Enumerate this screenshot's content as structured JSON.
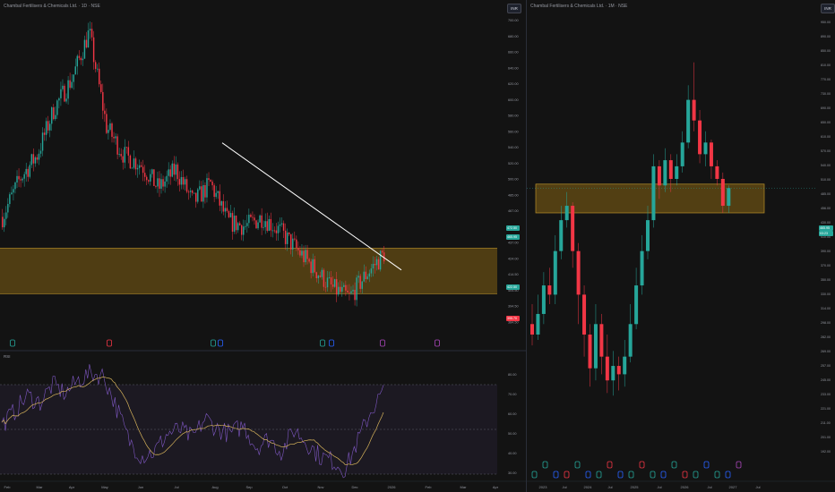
{
  "left_chart": {
    "title": "Chambal Fertilisers & Chemicals Ltd. · 1D · NSE",
    "scale_label": "INR",
    "indicator_label": "RSI",
    "price_labels": [
      "700.00",
      "680.00",
      "660.00",
      "640.00",
      "620.00",
      "600.00",
      "580.00",
      "560.00",
      "540.00",
      "520.00",
      "500.00",
      "485.00",
      "467.00",
      "450.00",
      "437.00",
      "424.00",
      "414.50",
      "404.50",
      "394.50",
      "384.50"
    ],
    "price_badges": [
      {
        "text": "472.50",
        "color": "#26a69a"
      },
      {
        "text": "465.95",
        "color": "#26a69a"
      },
      {
        "text": "422.50",
        "color": "#26a69a"
      },
      {
        "text": "395.70",
        "color": "#f23645"
      }
    ],
    "rsi_labels": [
      "80.00",
      "70.00",
      "60.00",
      "50.00",
      "40.00",
      "30.00"
    ],
    "x_labels": [
      "Feb",
      "Mar",
      "Apr",
      "May",
      "Jun",
      "Jul",
      "Aug",
      "Sep",
      "Oct",
      "Nov",
      "Dec",
      "2026",
      "Feb",
      "Mar",
      "Apr"
    ],
    "colors": {
      "up": "#26a69a",
      "down": "#f23645",
      "zone": "#5a4514",
      "zone_line": "#b8902a",
      "trend": "#ffffff",
      "rsi": "#7e57c2",
      "rsi_ma": "#d4b15a"
    }
  },
  "right_chart": {
    "title": "Chambal Fertilisers & Chemicals Ltd. · 1M · NSE",
    "scale_label": "INR",
    "price_labels": [
      "1,100.00",
      "950.00",
      "890.00",
      "850.00",
      "810.00",
      "770.00",
      "730.00",
      "690.00",
      "650.00",
      "610.00",
      "570.00",
      "540.00",
      "510.00",
      "485.00",
      "456.00",
      "430.00",
      "410.00",
      "390.00",
      "370.00",
      "350.00",
      "330.00",
      "314.00",
      "298.00",
      "282.00",
      "269.00",
      "257.00",
      "245.00",
      "233.00",
      "221.00",
      "211.00",
      "201.00",
      "192.00"
    ],
    "price_badges": [
      {
        "text": "465.95",
        "color": "#26a69a"
      },
      {
        "text": "03:23",
        "color": "#26a69a"
      }
    ],
    "x_labels": [
      "2023",
      "Jul",
      "2024",
      "Jul",
      "2025",
      "Jul",
      "2026",
      "Jul",
      "2027",
      "Jul"
    ],
    "colors": {
      "up": "#26a69a",
      "down": "#f23645",
      "zone": "#5a4514",
      "zone_line": "#b8902a"
    }
  },
  "chart_data": [
    {
      "type": "candlestick",
      "title": "Chambal Fertilisers & Chemicals Ltd. · 1D · NSE",
      "x": [
        "Feb",
        "Mar",
        "Apr",
        "May",
        "Jun",
        "Jul",
        "Aug",
        "Sep",
        "Oct",
        "Nov",
        "Dec"
      ],
      "close_path": [
        505,
        545,
        570,
        620,
        650,
        700,
        600,
        570,
        560,
        535,
        555,
        520,
        540,
        500,
        495,
        505,
        490,
        470,
        450,
        430,
        420,
        445,
        466
      ],
      "support_zone": [
        424,
        472
      ],
      "trendline": {
        "from": {
          "x": "Aug",
          "y": 583
        },
        "to": {
          "x": "Dec",
          "y": 466
        }
      },
      "indicator": {
        "name": "RSI",
        "ylim": [
          30,
          80
        ],
        "bands": [
          70,
          50,
          30
        ]
      }
    },
    {
      "type": "candlestick",
      "title": "Chambal Fertilisers & Chemicals Ltd. · 1M · NSE",
      "x": [
        "2023",
        "Jul",
        "2024",
        "Jul",
        "2025",
        "Jul",
        "2026"
      ],
      "support_zone": [
        430,
        472
      ],
      "last_price": 465.95
    }
  ]
}
